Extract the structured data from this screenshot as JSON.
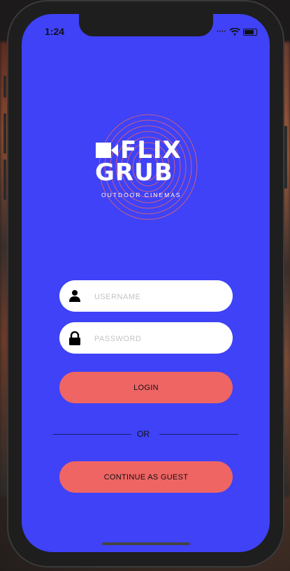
{
  "status_bar": {
    "time": "1:24",
    "signal": "••••"
  },
  "logo": {
    "line1": "FLIX",
    "line2": "GRUB",
    "subtitle": "OUTDOOR CINEMAS"
  },
  "form": {
    "username_placeholder": "USERNAME",
    "password_placeholder": "PASSWORD",
    "login_label": "LOGIN",
    "or_label": "OR",
    "guest_label": "CONTINUE AS GUEST"
  },
  "colors": {
    "background": "#3f42f6",
    "accent": "#ee6564",
    "field": "#ffffff"
  },
  "icons": {
    "username": "user-icon",
    "password": "lock-icon",
    "logo": "camera-icon"
  }
}
